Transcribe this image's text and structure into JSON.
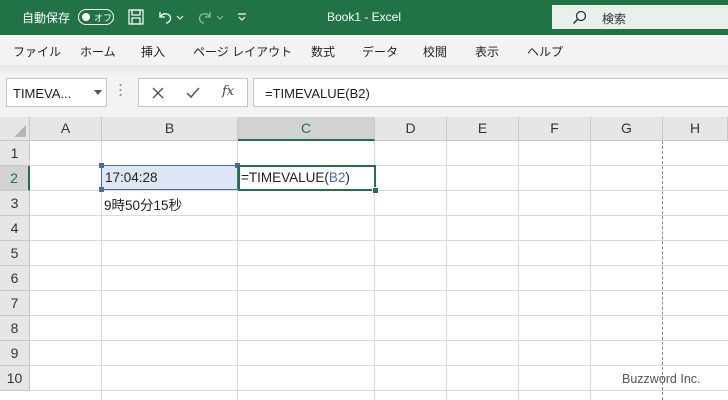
{
  "titlebar": {
    "autosave_label": "自動保存",
    "autosave_toggle": "オフ",
    "title": "Book1  -  Excel",
    "search_placeholder": "検索",
    "icons": [
      "save-icon",
      "undo-icon",
      "redo-icon",
      "customize-qat-icon",
      "search-icon"
    ]
  },
  "ribbon": {
    "tabs": [
      "ファイル",
      "ホーム",
      "挿入",
      "ページ レイアウト",
      "数式",
      "データ",
      "校閲",
      "表示",
      "ヘルプ"
    ]
  },
  "formula_bar": {
    "name_box": "TIMEVA...",
    "formula": "=TIMEVALUE(B2)"
  },
  "sheet": {
    "columns": [
      "A",
      "B",
      "C",
      "D",
      "E",
      "F",
      "G",
      "H"
    ],
    "rows": [
      "1",
      "2",
      "3",
      "4",
      "5",
      "6",
      "7",
      "8",
      "9",
      "10"
    ],
    "active_column": "C",
    "active_row": "2",
    "cells": {
      "B2": "17:04:28",
      "C2_prefix": "=TIMEVALUE(",
      "C2_ref": "B2",
      "C2_suffix": ")",
      "B3": "9時50分15秒"
    }
  },
  "watermark": "Buzzword Inc.",
  "colors": {
    "accent": "#217346",
    "reference": "#4a6aa9",
    "reference_fill": "#dde7f4"
  }
}
